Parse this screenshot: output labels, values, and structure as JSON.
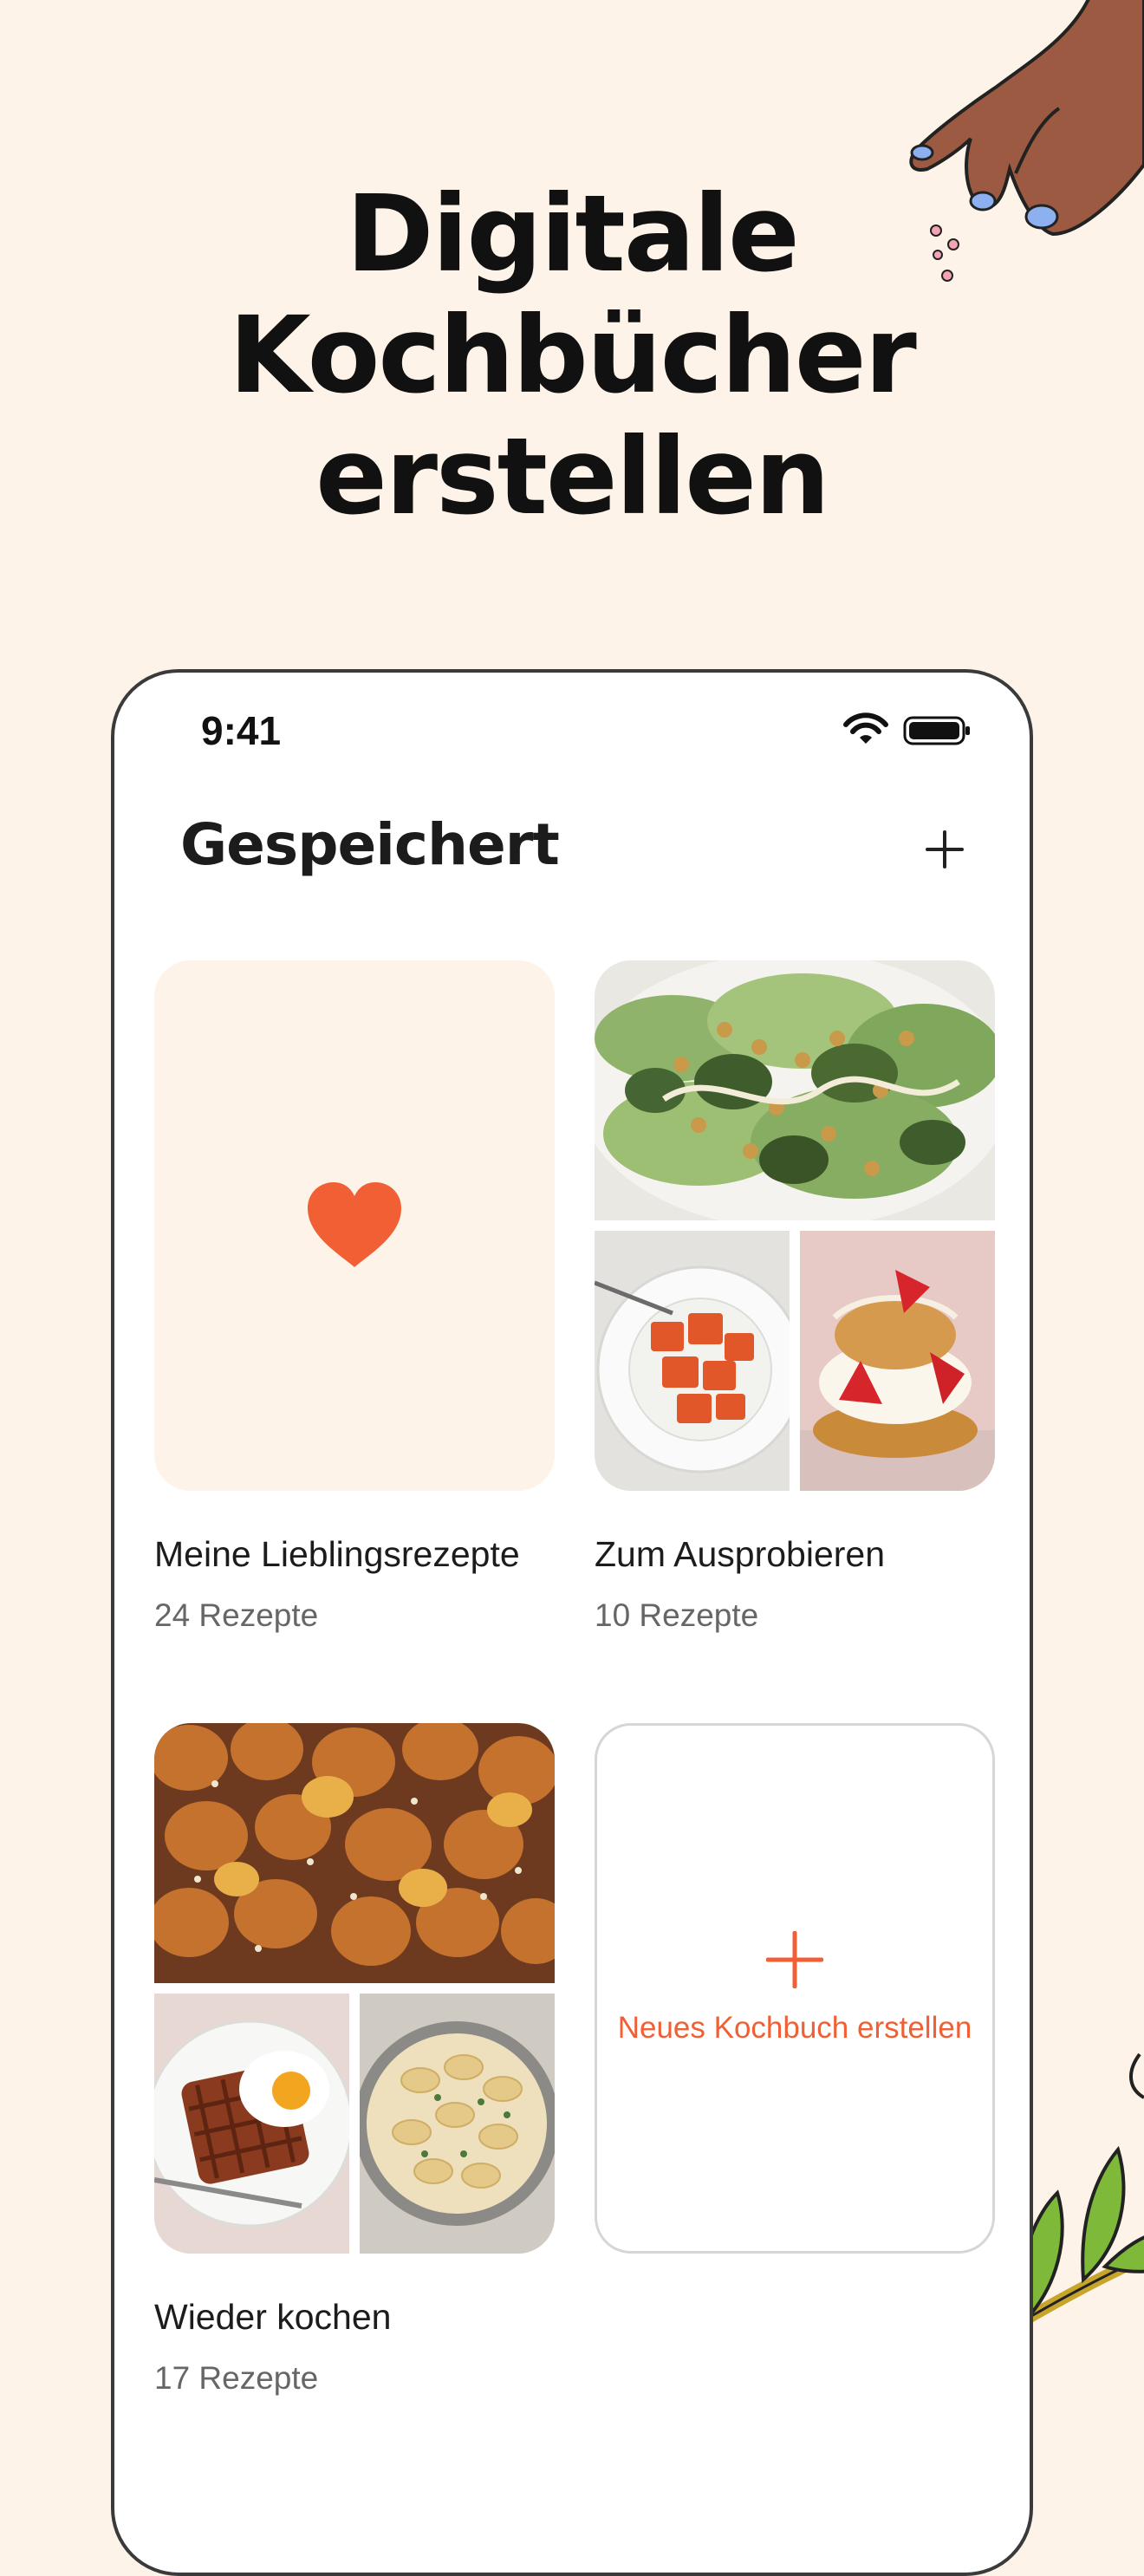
{
  "headline": {
    "line1": "Digitale",
    "line2": "Kochbücher",
    "line3": "erstellen"
  },
  "status_bar": {
    "time": "9:41"
  },
  "screen": {
    "title": "Gespeichert"
  },
  "cookbooks": [
    {
      "name": "Meine Lieblingsrezepte",
      "count": "24 Rezepte",
      "cover": "heart-icon"
    },
    {
      "name": "Zum Ausprobieren",
      "count": "10 Rezepte",
      "cover": "photo-collage"
    },
    {
      "name": "Wieder kochen",
      "count": "17 Rezepte",
      "cover": "photo-collage"
    }
  ],
  "new_cookbook": {
    "label": "Neues Kochbuch erstellen"
  },
  "colors": {
    "background": "#fdf3e8",
    "accent": "#f06034",
    "text": "#1c1c1c",
    "muted": "#666666"
  }
}
